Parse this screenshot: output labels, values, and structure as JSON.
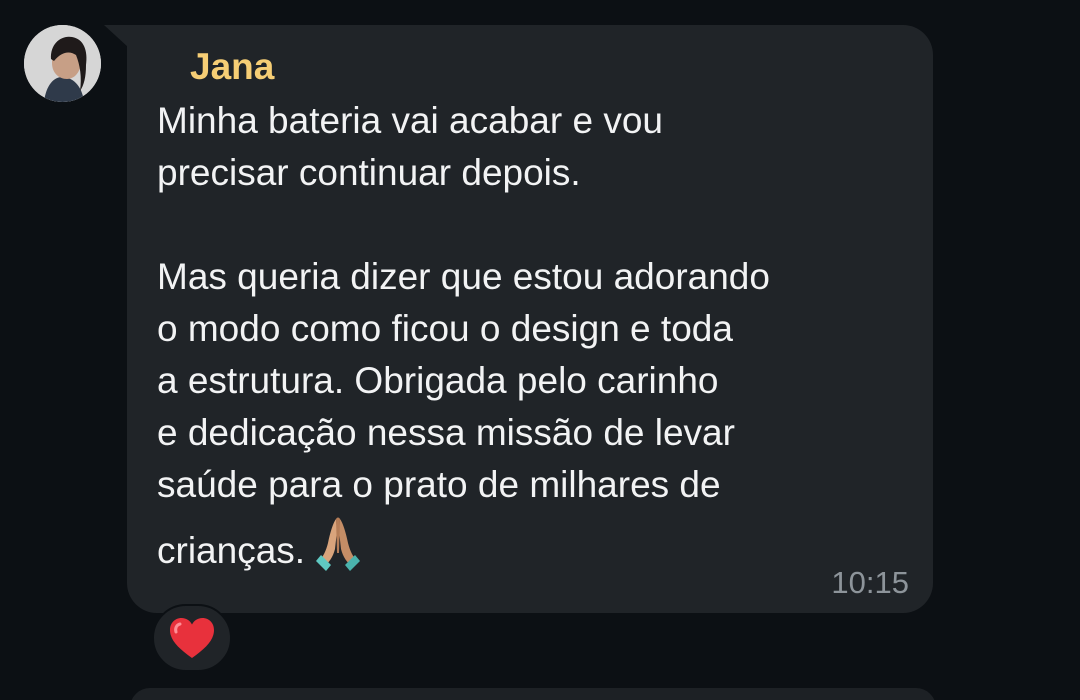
{
  "message": {
    "sender": "Jana",
    "text": "Minha bateria vai acabar e vou\nprecisar continuar depois.\n\nMas queria dizer que estou adorando\no modo como ficou o design e toda\na estrutura. Obrigada pelo carinho\ne dedicação nessa missão de levar\nsaúde para o prato de milhares de\ncrianças.",
    "emoji": "folded-hands-icon",
    "time": "10:15",
    "reaction": "heart-icon"
  },
  "colors": {
    "background": "#0c1014",
    "bubble": "#202428",
    "sender_name": "#f6ce75",
    "text": "#f2f3f4",
    "timestamp": "#8d949a",
    "heart": "#e8313c"
  }
}
